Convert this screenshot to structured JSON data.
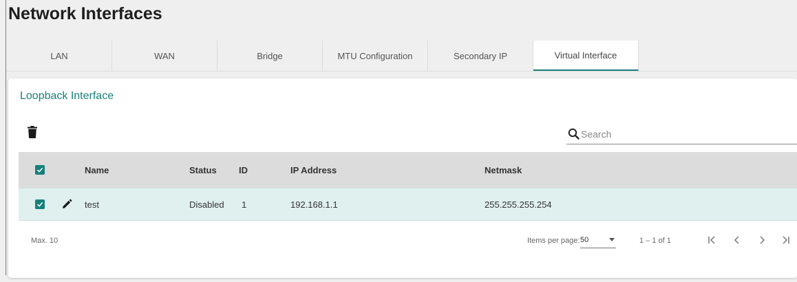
{
  "page": {
    "title": "Network Interfaces"
  },
  "tabs": [
    {
      "label": "LAN"
    },
    {
      "label": "WAN"
    },
    {
      "label": "Bridge"
    },
    {
      "label": "MTU Configuration"
    },
    {
      "label": "Secondary IP"
    },
    {
      "label": "Virtual Interface"
    }
  ],
  "active_tab": "Virtual Interface",
  "section": {
    "title": "Loopback Interface"
  },
  "search": {
    "placeholder": "Search",
    "value": ""
  },
  "table": {
    "columns": [
      "Name",
      "Status",
      "ID",
      "IP Address",
      "Netmask"
    ],
    "rows": [
      {
        "name": "test",
        "status": "Disabled",
        "id": "1",
        "ip": "192.168.1.1",
        "netmask": "255.255.255.254",
        "checked": true
      }
    ]
  },
  "footer": {
    "max_label": "Max. 10",
    "items_per_page_label": "Items per page:",
    "items_per_page_value": "50",
    "range": "1 – 1 of 1"
  },
  "icons": {
    "delete": "trash-icon",
    "search": "search-icon",
    "edit": "pencil-icon",
    "pager": [
      "first-page-icon",
      "prev-page-icon",
      "next-page-icon",
      "last-page-icon"
    ]
  },
  "colors": {
    "accent": "#17807b",
    "row_selected": "#e0f0ef",
    "header_bg": "#dcdcdc"
  }
}
